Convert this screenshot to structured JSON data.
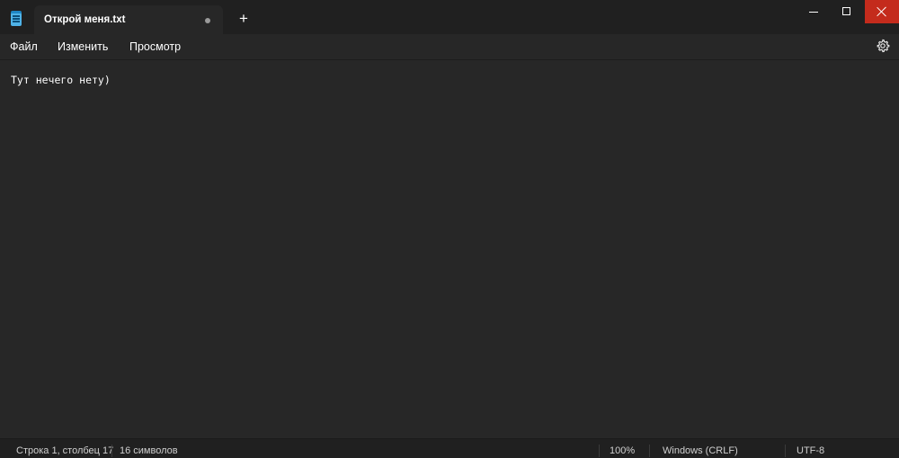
{
  "tab": {
    "title": "Открой меня.txt"
  },
  "titlebar": {
    "new_tab_label": "+"
  },
  "menu": {
    "items": [
      {
        "label": "Файл"
      },
      {
        "label": "Изменить"
      },
      {
        "label": "Просмотр"
      }
    ]
  },
  "editor": {
    "content": "Тут нечего нету)"
  },
  "statusbar": {
    "position": "Строка 1, столбец 17",
    "characters": "16 символов",
    "zoom": "100%",
    "line_ending": "Windows (CRLF)",
    "encoding": "UTF-8"
  },
  "colors": {
    "background": "#272727",
    "titlebar": "#202020",
    "close_button": "#c42b1c",
    "app_icon": "#4fb3e8"
  },
  "icons": {
    "app": "notepad-icon",
    "settings": "gear-icon",
    "minimize": "minimize-icon",
    "maximize": "maximize-icon",
    "close": "close-icon"
  }
}
